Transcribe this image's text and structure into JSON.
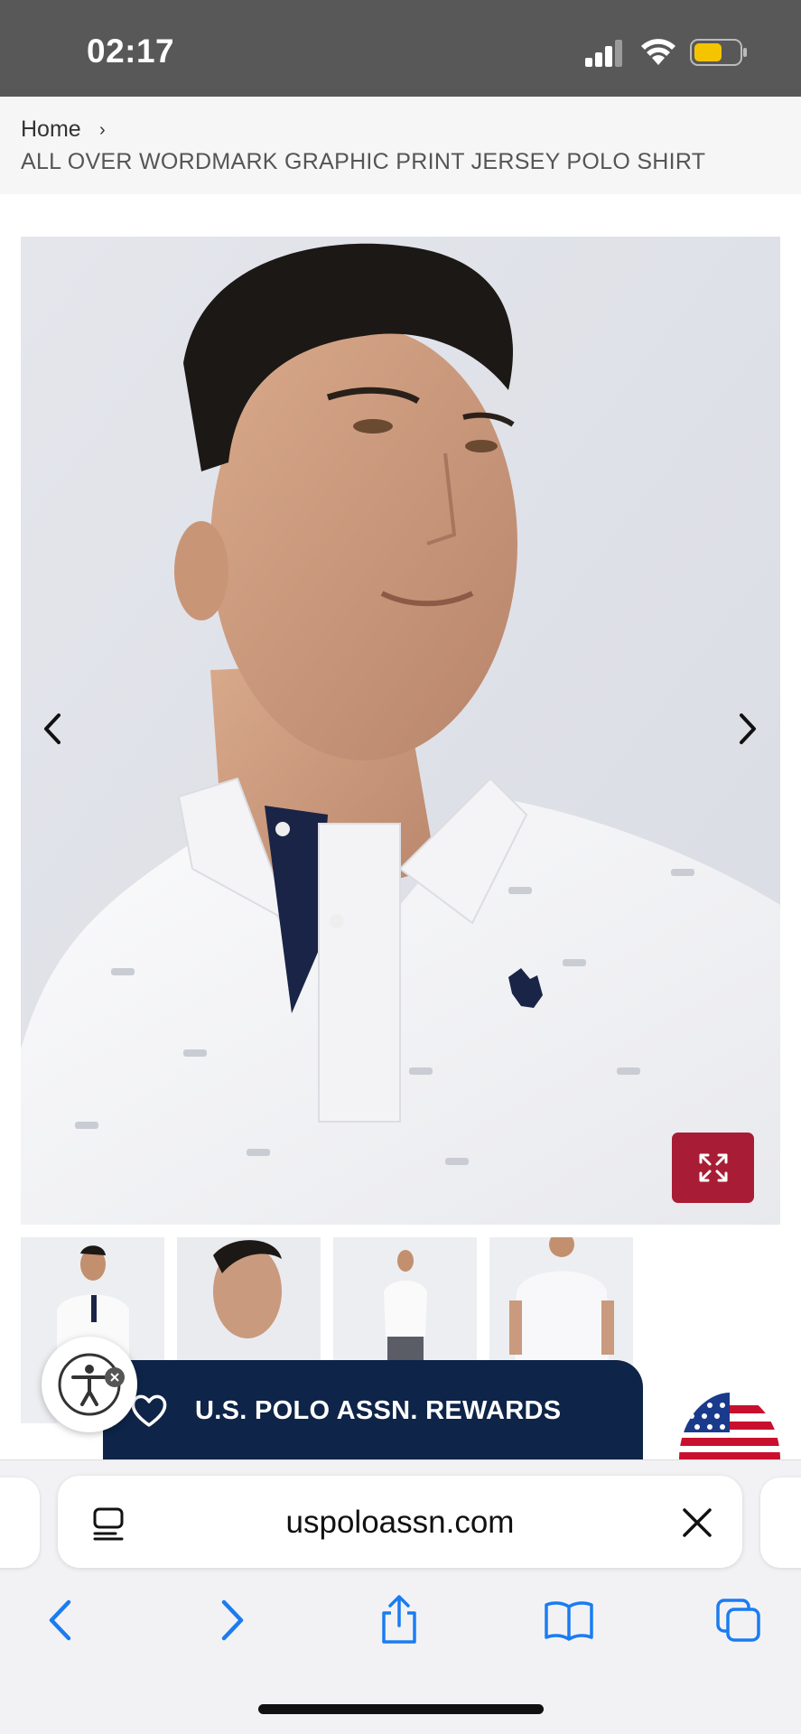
{
  "status_bar": {
    "time": "02:17",
    "icons": [
      "signal-icon",
      "wifi-icon",
      "battery-icon"
    ],
    "battery_color": "#f5c400"
  },
  "breadcrumb": {
    "home": "Home",
    "separator": "›",
    "current": "ALL OVER WORDMARK GRAPHIC PRINT JERSEY POLO SHIRT"
  },
  "gallery": {
    "main_image": "model-portrait-white-polo",
    "prev_icon": "chevron-left-icon",
    "next_icon": "chevron-right-icon",
    "zoom_icon": "expand-icon",
    "zoom_button_color": "#a81d35",
    "thumbnails": [
      "thumb-front-full",
      "thumb-side-portrait",
      "thumb-front-standing",
      "thumb-back-view"
    ]
  },
  "rewards": {
    "label": "U.S. POLO ASSN. REWARDS",
    "icon": "heart-icon",
    "background": "#0e2448"
  },
  "accessibility": {
    "icon": "accessibility-icon",
    "close_icon": "close-icon"
  },
  "browser": {
    "url": "uspoloassn.com",
    "reader_icon": "reader-icon",
    "clear_icon": "close-icon",
    "toolbar": [
      "back-icon",
      "forward-icon",
      "share-icon",
      "bookmarks-icon",
      "tabs-icon"
    ],
    "accent": "#1a7cf2"
  }
}
